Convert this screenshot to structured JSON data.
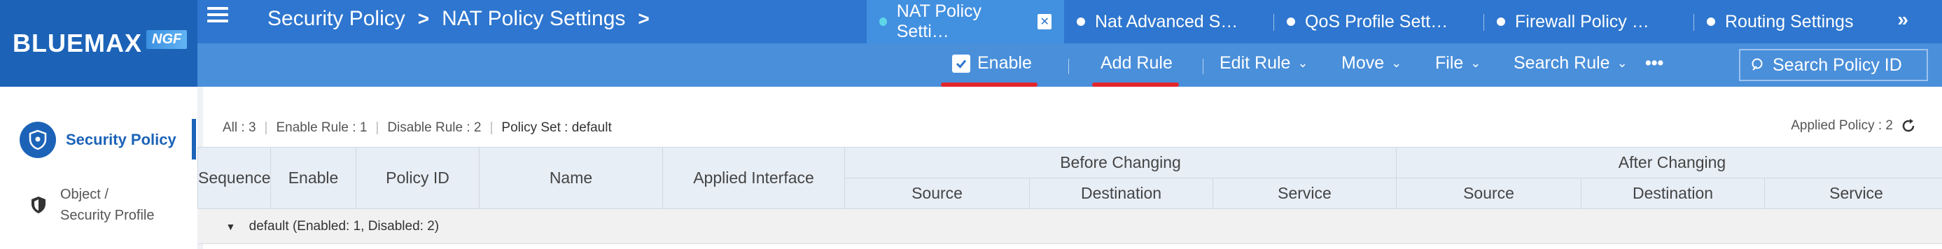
{
  "brand": {
    "name": "BLUEMAX",
    "suffix": "NGF",
    "color": "#1c63b8"
  },
  "breadcrumb": {
    "section": "Security Policy",
    "page": "NAT Policy Settings",
    "separator": ">"
  },
  "tabs": [
    {
      "label": "NAT Policy Setti…",
      "active": true,
      "close": "✕"
    },
    {
      "label": "Nat Advanced S…",
      "active": false
    },
    {
      "label": "QoS Profile Sett…",
      "active": false
    },
    {
      "label": "Firewall Policy …",
      "active": false
    },
    {
      "label": "Routing Settings",
      "active": false
    }
  ],
  "tabs_more": "»",
  "toolbar": {
    "enable": {
      "label": "Enable",
      "checked": true
    },
    "add_rule": "Add Rule",
    "edit_rule": "Edit Rule",
    "move": "Move",
    "file": "File",
    "search_rule": "Search Rule",
    "more": "•••",
    "search_policy_id": "Search Policy ID",
    "chevron": "⌄"
  },
  "sidebar": {
    "items": [
      {
        "label": "Security Policy",
        "active": true,
        "icon": "shield-icon"
      },
      {
        "label_line1": "Object /",
        "label_line2": "Security Profile",
        "active": false,
        "icon": "shield-half-icon"
      }
    ]
  },
  "summary": {
    "all": "All : 3",
    "enable_rule": "Enable Rule : 1",
    "disable_rule": "Disable Rule : 2",
    "policy_set": "Policy Set : default",
    "applied_policy": "Applied Policy : 2"
  },
  "table": {
    "columns": {
      "sequence": "Sequence",
      "enable": "Enable",
      "policy_id": "Policy ID",
      "name": "Name",
      "applied_interface": "Applied Interface",
      "before_changing": "Before Changing",
      "after_changing": "After Changing",
      "source": "Source",
      "destination": "Destination",
      "service": "Service"
    },
    "group_row": "default (Enabled: 1, Disabled: 2)"
  },
  "colors": {
    "topnav": "#2e76cf",
    "toolbar": "#4a8fda",
    "active_tab": "#4290e0",
    "annotation": "#e2262c",
    "header_bg": "#e8eef6"
  }
}
